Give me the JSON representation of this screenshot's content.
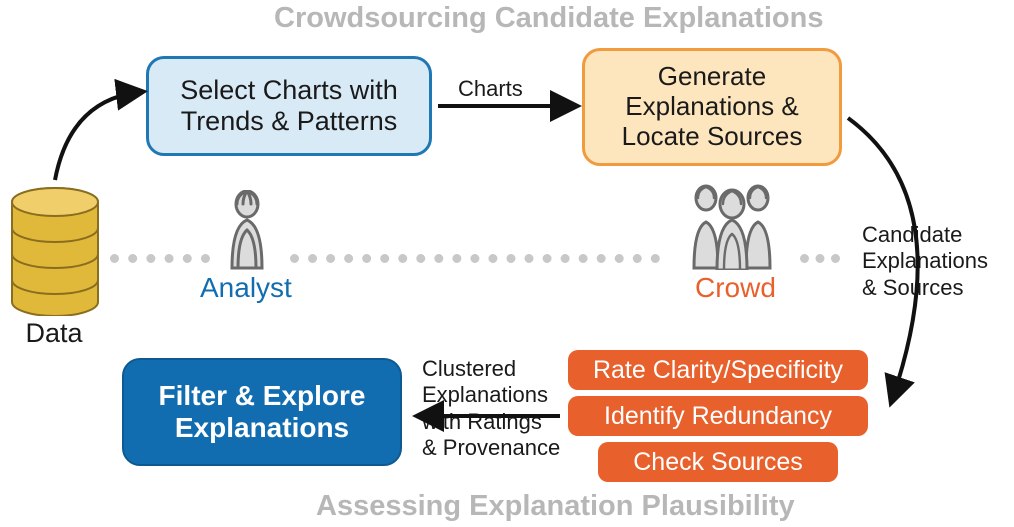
{
  "titles": {
    "top": "Crowdsourcing Candidate Explanations",
    "bottom": "Assessing Explanation Plausibility"
  },
  "nodes": {
    "select_charts": "Select Charts with\nTrends & Patterns",
    "generate": "Generate\nExplanations &\nLocate Sources",
    "filter": "Filter & Explore\nExplanations",
    "rate": "Rate Clarity/Specificity",
    "identify": "Identify Redundancy",
    "check": "Check Sources"
  },
  "edges": {
    "charts": "Charts",
    "candidate": "Candidate\nExplanations\n& Sources",
    "clustered": "Clustered\nExplanations\nwith Ratings\n& Provenance"
  },
  "roles": {
    "analyst": "Analyst",
    "crowd": "Crowd",
    "data": "Data"
  },
  "colors": {
    "analyst": "#126db0",
    "crowd": "#e8602c",
    "db": "#e0b93a",
    "db_dark": "#b58f1e"
  }
}
